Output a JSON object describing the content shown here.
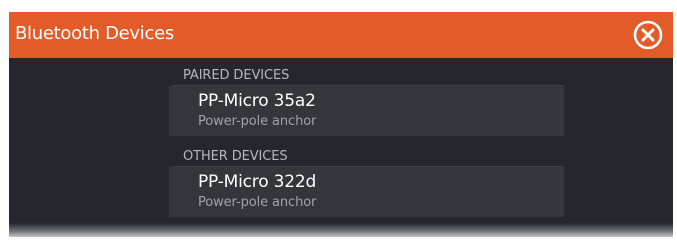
{
  "dialog": {
    "title": "Bluetooth Devices",
    "close_icon": "close-icon",
    "accent_color": "#e25b28"
  },
  "paired": {
    "header": "PAIRED DEVICES",
    "devices": [
      {
        "name": "PP-Micro 35a2",
        "type": "Power-pole anchor"
      }
    ]
  },
  "other": {
    "header": "OTHER DEVICES",
    "devices": [
      {
        "name": "PP-Micro 322d",
        "type": "Power-pole anchor"
      }
    ]
  }
}
